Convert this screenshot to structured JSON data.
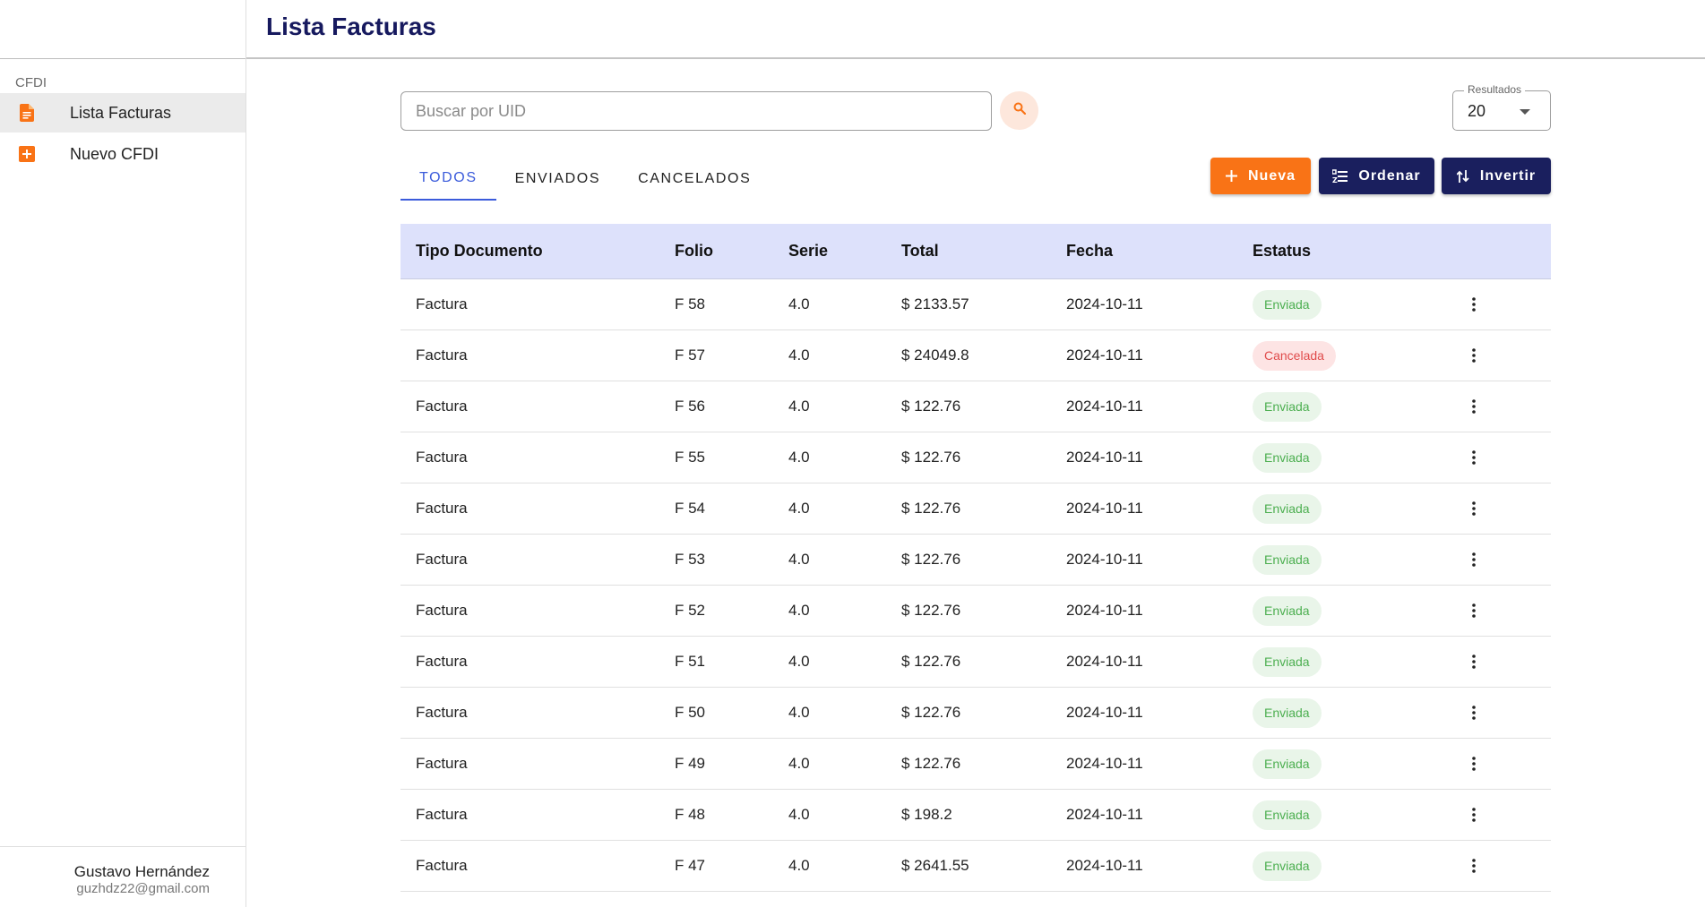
{
  "header": {
    "title": "Lista Facturas"
  },
  "sidebar": {
    "section": "CFDI",
    "items": [
      {
        "label": "Lista Facturas",
        "icon": "document-icon",
        "active": true
      },
      {
        "label": "Nuevo CFDI",
        "icon": "add-box-icon",
        "active": false
      }
    ],
    "user": {
      "name": "Gustavo Hernández",
      "email": "guzhdz22@gmail.com"
    }
  },
  "search": {
    "placeholder": "Buscar por UID",
    "value": ""
  },
  "results": {
    "label": "Resultados",
    "value": "20"
  },
  "tabs": [
    {
      "label": "TODOS",
      "active": true
    },
    {
      "label": "ENVIADOS",
      "active": false
    },
    {
      "label": "CANCELADOS",
      "active": false
    }
  ],
  "buttons": {
    "new_label": "Nueva",
    "sort_label": "Ordenar",
    "invert_label": "Invertir"
  },
  "colors": {
    "accent": "#f97316",
    "navy": "#1a1f5e",
    "header_bg": "#dde1fb",
    "tab_active": "#3b5bdb"
  },
  "table": {
    "columns": [
      "Tipo Documento",
      "Folio",
      "Serie",
      "Total",
      "Fecha",
      "Estatus"
    ],
    "rows": [
      {
        "tipo": "Factura",
        "folio": "F 58",
        "serie": "4.0",
        "total": "$ 2133.57",
        "fecha": "2024-10-11",
        "estatus": "Enviada",
        "status_type": "ok"
      },
      {
        "tipo": "Factura",
        "folio": "F 57",
        "serie": "4.0",
        "total": "$ 24049.8",
        "fecha": "2024-10-11",
        "estatus": "Cancelada",
        "status_type": "cancel"
      },
      {
        "tipo": "Factura",
        "folio": "F 56",
        "serie": "4.0",
        "total": "$ 122.76",
        "fecha": "2024-10-11",
        "estatus": "Enviada",
        "status_type": "ok"
      },
      {
        "tipo": "Factura",
        "folio": "F 55",
        "serie": "4.0",
        "total": "$ 122.76",
        "fecha": "2024-10-11",
        "estatus": "Enviada",
        "status_type": "ok"
      },
      {
        "tipo": "Factura",
        "folio": "F 54",
        "serie": "4.0",
        "total": "$ 122.76",
        "fecha": "2024-10-11",
        "estatus": "Enviada",
        "status_type": "ok"
      },
      {
        "tipo": "Factura",
        "folio": "F 53",
        "serie": "4.0",
        "total": "$ 122.76",
        "fecha": "2024-10-11",
        "estatus": "Enviada",
        "status_type": "ok"
      },
      {
        "tipo": "Factura",
        "folio": "F 52",
        "serie": "4.0",
        "total": "$ 122.76",
        "fecha": "2024-10-11",
        "estatus": "Enviada",
        "status_type": "ok"
      },
      {
        "tipo": "Factura",
        "folio": "F 51",
        "serie": "4.0",
        "total": "$ 122.76",
        "fecha": "2024-10-11",
        "estatus": "Enviada",
        "status_type": "ok"
      },
      {
        "tipo": "Factura",
        "folio": "F 50",
        "serie": "4.0",
        "total": "$ 122.76",
        "fecha": "2024-10-11",
        "estatus": "Enviada",
        "status_type": "ok"
      },
      {
        "tipo": "Factura",
        "folio": "F 49",
        "serie": "4.0",
        "total": "$ 122.76",
        "fecha": "2024-10-11",
        "estatus": "Enviada",
        "status_type": "ok"
      },
      {
        "tipo": "Factura",
        "folio": "F 48",
        "serie": "4.0",
        "total": "$ 198.2",
        "fecha": "2024-10-11",
        "estatus": "Enviada",
        "status_type": "ok"
      },
      {
        "tipo": "Factura",
        "folio": "F 47",
        "serie": "4.0",
        "total": "$ 2641.55",
        "fecha": "2024-10-11",
        "estatus": "Enviada",
        "status_type": "ok"
      }
    ]
  }
}
